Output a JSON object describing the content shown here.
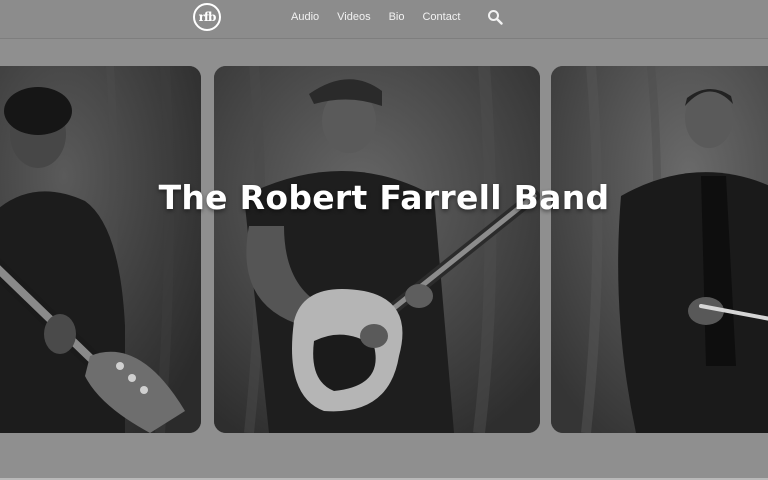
{
  "header": {
    "logo_text": "rfb",
    "nav": [
      {
        "label": "Audio"
      },
      {
        "label": "Videos"
      },
      {
        "label": "Bio"
      },
      {
        "label": "Contact"
      }
    ],
    "search_icon": "search-icon"
  },
  "hero": {
    "title": "The Robert Farrell Band"
  },
  "colors": {
    "background": "#8f8f8f",
    "navbar": "#8c8c8c",
    "nav_text": "#f2f2f2",
    "title_text": "#ffffff"
  }
}
